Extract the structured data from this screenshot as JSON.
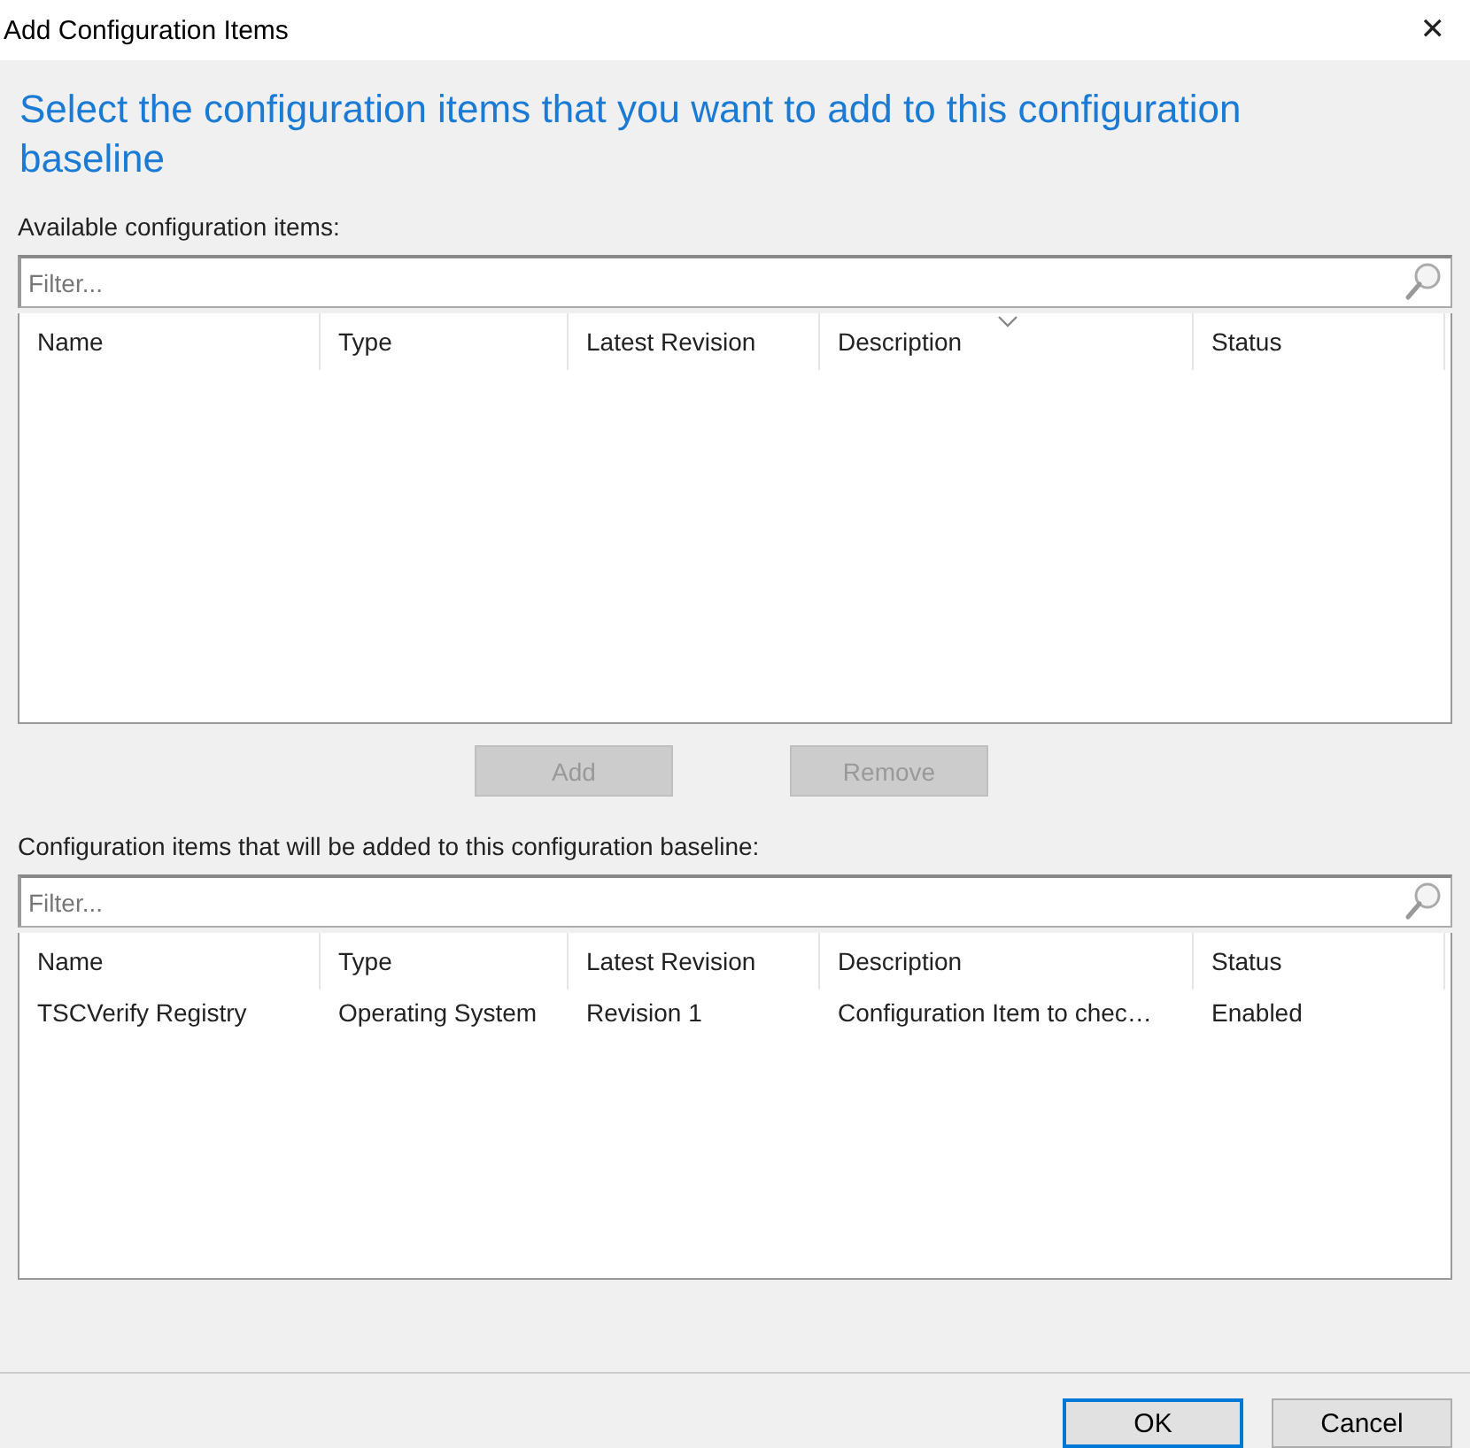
{
  "window": {
    "title": "Add Configuration Items",
    "close": "✕"
  },
  "heading": "Select the configuration items that you want to add to this configuration baseline",
  "available": {
    "label": "Available configuration items:",
    "filter": {
      "placeholder": "Filter..."
    },
    "columns": [
      {
        "label": "Name",
        "sorted": false
      },
      {
        "label": "Type",
        "sorted": false
      },
      {
        "label": "Latest Revision",
        "sorted": false
      },
      {
        "label": "Description",
        "sorted": true
      },
      {
        "label": "Status",
        "sorted": false
      }
    ]
  },
  "actions": [
    {
      "label": "Add",
      "disabled": true
    },
    {
      "label": "Remove",
      "disabled": true
    }
  ],
  "added": {
    "label": "Configuration items that will be added to this configuration baseline:",
    "filter": {
      "placeholder": "Filter..."
    },
    "columns": [
      {
        "label": "Name",
        "sorted": false
      },
      {
        "label": "Type",
        "sorted": false
      },
      {
        "label": "Latest Revision",
        "sorted": false
      },
      {
        "label": "Description",
        "sorted": false
      },
      {
        "label": "Status",
        "sorted": false
      }
    ],
    "rows": [
      {
        "cells": [
          "TSCVerify Registry",
          "Operating System",
          "Revision 1",
          "Configuration Item to chec…",
          "Enabled"
        ]
      }
    ]
  },
  "buttons": [
    {
      "label": "OK",
      "default": true
    },
    {
      "label": "Cancel",
      "default": false
    }
  ]
}
